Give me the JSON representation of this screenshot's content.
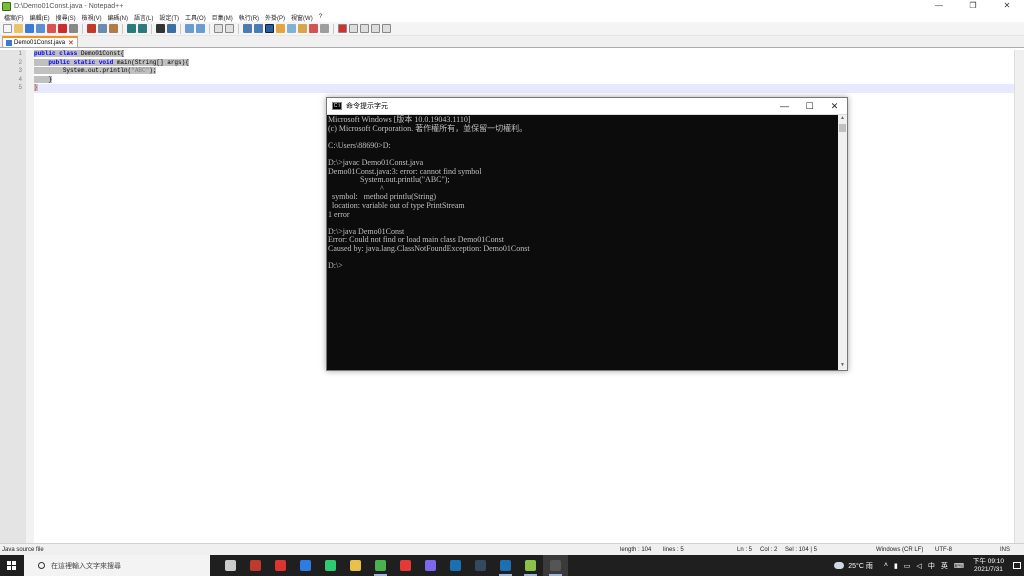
{
  "npp": {
    "title": "D:\\Demo01Const.java - Notepad++",
    "window_controls": [
      "—",
      "❐",
      "✕"
    ],
    "menu": [
      "檔案(F)",
      "編輯(E)",
      "搜尋(S)",
      "檢視(V)",
      "編碼(N)",
      "語言(L)",
      "設定(T)",
      "工具(O)",
      "巨集(M)",
      "執行(R)",
      "外掛(P)",
      "視窗(W)",
      "?"
    ],
    "tab_label": "Demo01Const.java",
    "line_numbers": [
      "1",
      "2",
      "3",
      "4",
      "5"
    ],
    "code": {
      "l1_kw": "public class",
      "l1_rest": " Demo01Const{",
      "l2_indent": "    ",
      "l2_kw": "public static void",
      "l2_rest": " main(String[] args){",
      "l3_indent": "        ",
      "l3_pre": "System.out.println(",
      "l3_str": "\"ABC\"",
      "l3_post": ");",
      "l4": "    }",
      "l5": "}"
    },
    "status": {
      "filetype": "Java source file",
      "length": "length : 104",
      "lines": "lines : 5",
      "ln": "Ln : 5",
      "col": "Col : 2",
      "sel": "Sel : 104 | 5",
      "eol": "Windows (CR LF)",
      "encoding": "UTF-8",
      "mode": "INS"
    }
  },
  "cmd": {
    "title": "命令提示字元",
    "icon_text": "C:\\",
    "controls": [
      "—",
      "☐",
      "✕"
    ],
    "lines": [
      "Microsoft Windows [版本 10.0.19043.1110]",
      "(c) Microsoft Corporation. 著作權所有，並保留一切權利。",
      "",
      "C:\\Users\\88690>D:",
      "",
      "D:\\>javac Demo01Const.java",
      "Demo01Const.java:3: error: cannot find symbol",
      "                System.out.printlu(\"ABC\");",
      "                          ^",
      "  symbol:   method printlu(String)",
      "  location: variable out of type PrintStream",
      "1 error",
      "",
      "D:\\>java Demo01Const",
      "Error: Could not find or load main class Demo01Const",
      "Caused by: java.lang.ClassNotFoundException: Demo01Const",
      "",
      "D:\\>"
    ]
  },
  "taskbar": {
    "search_placeholder": "在這裡輸入文字來搜尋",
    "weather": "25°C 雨",
    "ime_1": "中",
    "ime_2": "英",
    "time": "下午 09:10",
    "date": "2021/7/31",
    "app_colors": [
      "#cccccc",
      "#c0392b",
      "#d33",
      "#2d7be5",
      "#2ecc71",
      "#e8c14a",
      "#4caf50",
      "#e53935",
      "#7b68ee",
      "#1b6fb3",
      "#34495e",
      "#1b6fb3",
      "#8bc34a",
      "#555555"
    ]
  }
}
